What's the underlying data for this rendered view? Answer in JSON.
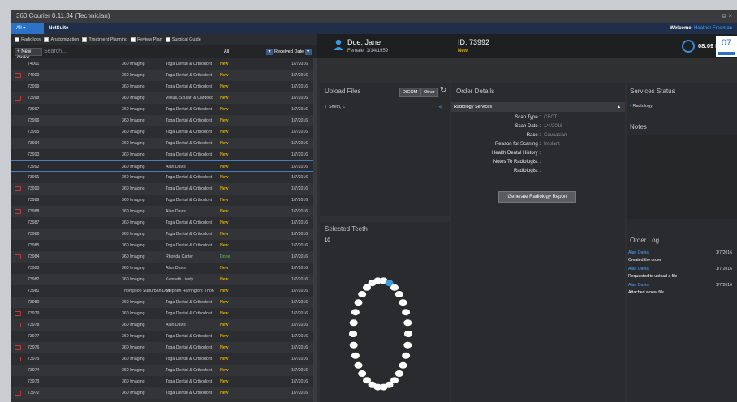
{
  "window": {
    "title": "360 Courier 0.11.34 (Technician)",
    "controls": "_ ⧉ ×"
  },
  "menu": {
    "all": "All",
    "netsuite": "NetSuite",
    "welcome": "Welcome,",
    "user": "Heather Freeman"
  },
  "filters": [
    "Radiology",
    "Anatomization",
    "Treatment Planning",
    "Review Plan",
    "Surgical Guide"
  ],
  "toolbar": {
    "new_order": "New Order",
    "search_placeholder": "Search...",
    "filter_all": "All",
    "sort": "Received Date"
  },
  "orders": [
    {
      "id": "74001",
      "center": "360 Imaging",
      "practice": "Toga Dental & Orthodont",
      "status": "New",
      "date": "1/7/2016",
      "mail": false
    },
    {
      "id": "74000",
      "center": "360 Imaging",
      "practice": "Toga Dental & Orthodont",
      "status": "New",
      "date": "1/7/2016",
      "mail": true
    },
    {
      "id": "73999",
      "center": "360 Imaging",
      "practice": "Toga Dental & Orthodont",
      "status": "New",
      "date": "1/7/2016",
      "mail": false
    },
    {
      "id": "73998",
      "center": "360 Imaging",
      "practice": "Vitkus, Szulari & Cardoso",
      "status": "New",
      "date": "1/7/2016",
      "mail": true
    },
    {
      "id": "73997",
      "center": "360 Imaging",
      "practice": "Toga Dental & Orthodont",
      "status": "New",
      "date": "1/7/2016",
      "mail": false
    },
    {
      "id": "73996",
      "center": "360 Imaging",
      "practice": "Toga Dental & Orthodont",
      "status": "New",
      "date": "1/7/2016",
      "mail": false
    },
    {
      "id": "73995",
      "center": "360 Imaging",
      "practice": "Toga Dental & Orthodont",
      "status": "New",
      "date": "1/7/2016",
      "mail": false
    },
    {
      "id": "73994",
      "center": "360 Imaging",
      "practice": "Toga Dental & Orthodont",
      "status": "New",
      "date": "1/7/2016",
      "mail": false
    },
    {
      "id": "73993",
      "center": "360 Imaging",
      "practice": "Toga Dental & Orthodont",
      "status": "New",
      "date": "1/7/2016",
      "mail": false
    },
    {
      "id": "73992",
      "center": "360 Imaging",
      "practice": "Alan Davis",
      "status": "New",
      "date": "1/7/2016",
      "mail": false,
      "selected": true
    },
    {
      "id": "73991",
      "center": "360 Imaging",
      "practice": "Toga Dental & Orthodont",
      "status": "New",
      "date": "1/7/2016",
      "mail": false
    },
    {
      "id": "73990",
      "center": "360 Imaging",
      "practice": "Toga Dental & Orthodont",
      "status": "New",
      "date": "1/7/2016",
      "mail": true
    },
    {
      "id": "73989",
      "center": "360 Imaging",
      "practice": "Toga Dental & Orthodont",
      "status": "New",
      "date": "1/7/2016",
      "mail": false
    },
    {
      "id": "73988",
      "center": "360 Imaging",
      "practice": "Alan Davis",
      "status": "New",
      "date": "1/7/2016",
      "mail": true
    },
    {
      "id": "73987",
      "center": "360 Imaging",
      "practice": "Toga Dental & Orthodont",
      "status": "New",
      "date": "1/7/2016",
      "mail": false
    },
    {
      "id": "73986",
      "center": "360 Imaging",
      "practice": "Toga Dental & Orthodont",
      "status": "New",
      "date": "1/7/2016",
      "mail": false
    },
    {
      "id": "73985",
      "center": "360 Imaging",
      "practice": "Toga Dental & Orthodont",
      "status": "New",
      "date": "1/7/2016",
      "mail": false
    },
    {
      "id": "73984",
      "center": "360 Imaging",
      "practice": "Rhonda Carter",
      "status": "Done",
      "date": "1/7/2016",
      "mail": true
    },
    {
      "id": "73983",
      "center": "360 Imaging",
      "practice": "Alan Davis",
      "status": "New",
      "date": "1/7/2016",
      "mail": false
    },
    {
      "id": "73982",
      "center": "360 Imaging",
      "practice": "Kenneth Lively",
      "status": "New",
      "date": "1/7/2016",
      "mail": false
    },
    {
      "id": "73981",
      "center": "Thompson Suburban Den",
      "practice": "Stephen Harrington: Thon",
      "status": "New",
      "date": "1/7/2016",
      "mail": false
    },
    {
      "id": "73980",
      "center": "360 Imaging",
      "practice": "Toga Dental & Orthodont",
      "status": "New",
      "date": "1/7/2016",
      "mail": false
    },
    {
      "id": "73979",
      "center": "360 Imaging",
      "practice": "Toga Dental & Orthodont",
      "status": "New",
      "date": "1/7/2016",
      "mail": true
    },
    {
      "id": "73978",
      "center": "360 Imaging",
      "practice": "Alan Davis",
      "status": "New",
      "date": "1/7/2016",
      "mail": true
    },
    {
      "id": "73977",
      "center": "360 Imaging",
      "practice": "Toga Dental & Orthodont",
      "status": "New",
      "date": "1/7/2016",
      "mail": false
    },
    {
      "id": "73976",
      "center": "360 Imaging",
      "practice": "Toga Dental & Orthodont",
      "status": "New",
      "date": "1/7/2016",
      "mail": true
    },
    {
      "id": "73975",
      "center": "360 Imaging",
      "practice": "Toga Dental & Orthodont",
      "status": "New",
      "date": "1/7/2016",
      "mail": true
    },
    {
      "id": "73974",
      "center": "360 Imaging",
      "practice": "Toga Dental & Orthodont",
      "status": "New",
      "date": "1/7/2016",
      "mail": false
    },
    {
      "id": "73973",
      "center": "360 Imaging",
      "practice": "Toga Dental & Orthodont",
      "status": "New",
      "date": "1/7/2016",
      "mail": false
    },
    {
      "id": "73972",
      "center": "360 Imaging",
      "practice": "Toga Dental & Orthodont",
      "status": "New",
      "date": "1/7/2016",
      "mail": true
    }
  ],
  "patient": {
    "name": "Doe, Jane",
    "gender": "Female",
    "dob": "1/14/1959",
    "id_label": "ID: 73992",
    "status": "New"
  },
  "clock": {
    "time": "08:09 PM",
    "day": "07",
    "day_label": "January"
  },
  "upload": {
    "title": "Upload Files",
    "dicom": "DICOM",
    "other": "Other",
    "file": "Smith, L"
  },
  "teeth": {
    "title": "Selected Teeth",
    "value": "10"
  },
  "order_details": {
    "title": "Order Details",
    "section": "Radiology Services",
    "fields": [
      {
        "k": "Scan Type :",
        "v": "CBCT"
      },
      {
        "k": "Scan Date :",
        "v": "1/4/2016"
      },
      {
        "k": "Race :",
        "v": "Caucasian"
      },
      {
        "k": "Reason for Scaning :",
        "v": "Implant"
      },
      {
        "k": "Health Dental History :",
        "v": ""
      },
      {
        "k": "Notes To Radiologist :",
        "v": ""
      },
      {
        "k": "Radiologist :",
        "v": ""
      }
    ],
    "generate": "Generate Radiology Report"
  },
  "services": {
    "title": "Services Status",
    "item": "Radiology"
  },
  "notes": {
    "title": "Notes"
  },
  "order_log": {
    "title": "Order Log",
    "entries": [
      {
        "who": "Alan Davis",
        "when": "1/7/2016",
        "action": "Created the order"
      },
      {
        "who": "Alan Davis",
        "when": "1/7/2016",
        "action": "Requested to upload a file"
      },
      {
        "who": "Alan Davis",
        "when": "1/7/2016",
        "action": "Attached a new file"
      }
    ]
  },
  "colors": {
    "accent": "#2a73c9",
    "new": "#ffd000",
    "done": "#5cc05c",
    "mail": "#c0393b",
    "selected_tooth": "#3a9be0"
  }
}
